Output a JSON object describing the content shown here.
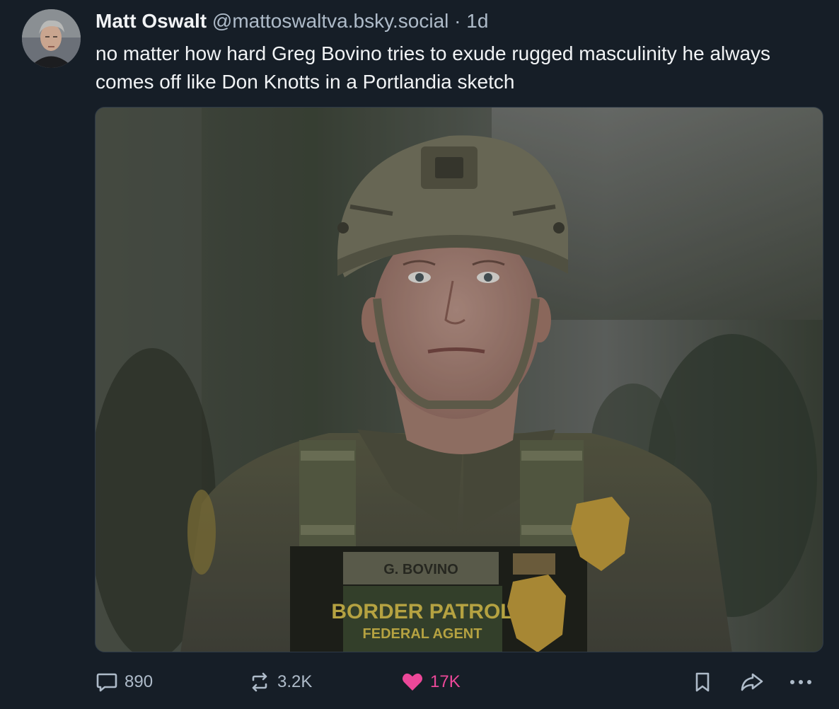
{
  "post": {
    "author": {
      "name": "Matt Oswalt",
      "handle": "@mattoswaltva.bsky.social",
      "separator": "·",
      "time": "1d",
      "avatar_icon": "profile-photo"
    },
    "text": "no matter how hard Greg Bovino tries to exude rugged masculinity he always comes off like Don Knotts in a Portlandia sketch",
    "image": {
      "name_tape": "G. BOVINO",
      "patch_line1": "BORDER PATROL",
      "patch_line2": "FEDERAL AGENT"
    },
    "stats": {
      "replies": "890",
      "reposts": "3.2K",
      "likes": "17K"
    },
    "icons": {
      "reply": "speech-bubble-icon",
      "repost": "repost-arrows-icon",
      "like": "heart-icon",
      "bookmark": "bookmark-icon",
      "share": "share-arrow-icon",
      "more": "ellipsis-icon"
    },
    "colors": {
      "background": "#161e27",
      "text_primary": "#f1f3f5",
      "text_secondary": "#aebbc9",
      "like_active": "#ec4899"
    }
  }
}
